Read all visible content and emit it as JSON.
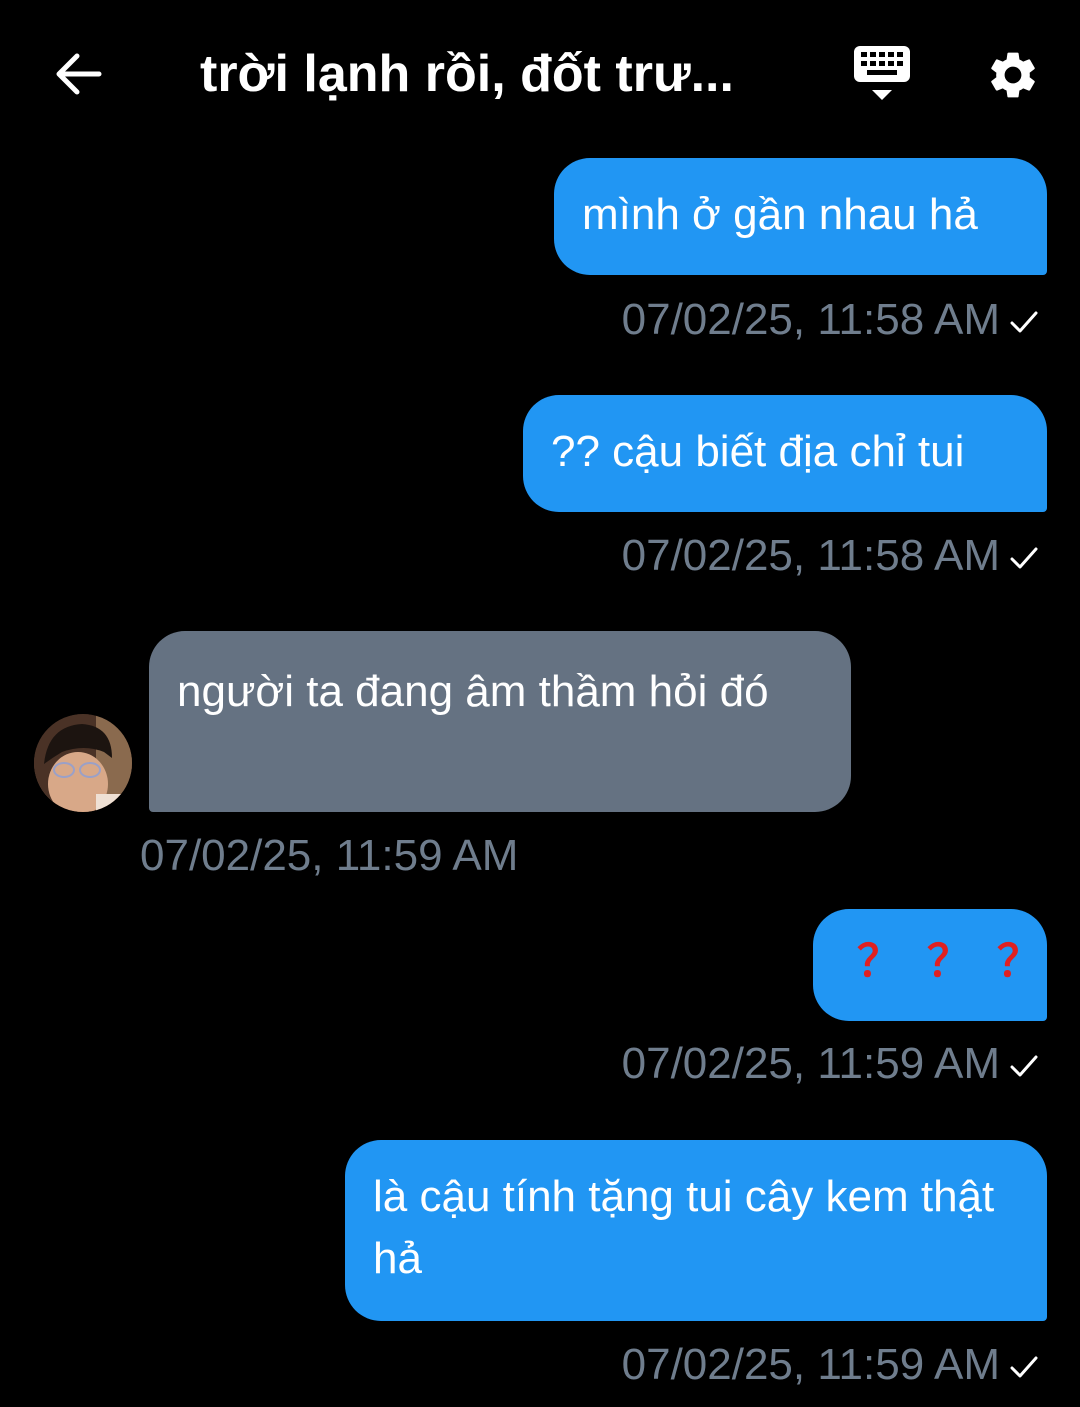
{
  "header": {
    "title": "trời lạnh rồi, đốt trư..."
  },
  "messages": [
    {
      "text": "mình ở gần nhau hả",
      "time": "07/02/25, 11:58 AM"
    },
    {
      "text": "?? cậu biết địa chỉ tui",
      "time": "07/02/25, 11:58 AM"
    },
    {
      "text": "người ta đang âm thầm hỏi đó",
      "time": "07/02/25, 11:59 AM"
    },
    {
      "text": "？？？",
      "time": "07/02/25, 11:59 AM"
    },
    {
      "text": "là cậu tính tặng tui cây kem thật hả",
      "time": "07/02/25, 11:59 AM"
    }
  ],
  "colors": {
    "sent_bubble": "#2196F3",
    "received_bubble": "#657282",
    "timestamp": "#6f7d8d",
    "question_marks": "#e02020"
  }
}
